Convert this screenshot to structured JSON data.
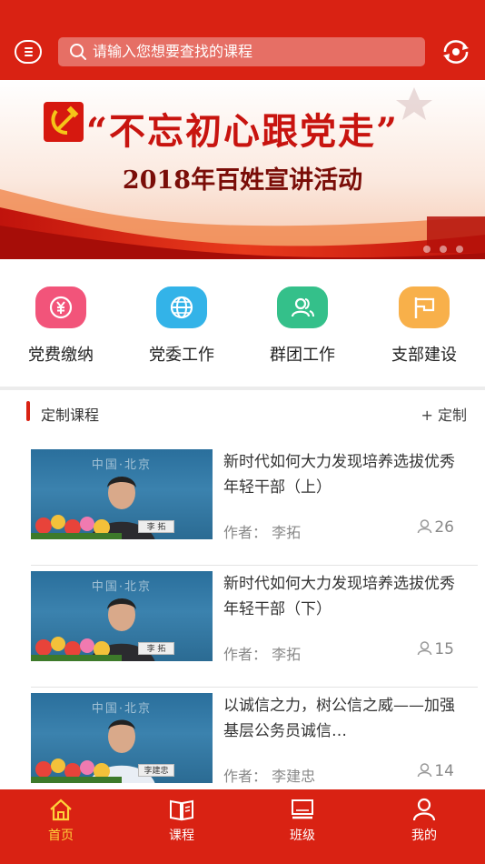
{
  "header": {
    "search_placeholder": "请输入您想要查找的课程",
    "icons": {
      "menu": "menu-icon",
      "search": "search-icon",
      "refresh": "refresh-icon"
    },
    "brand_color": "#d92213"
  },
  "banner": {
    "title": "“不忘初心跟党走”",
    "subtitle": "2018年百姓宣讲活动"
  },
  "quick_menu": [
    {
      "label": "党费缴纳",
      "icon": "yuan-exchange-icon",
      "color": "#f2547a"
    },
    {
      "label": "党委工作",
      "icon": "globe-icon",
      "color": "#33b3e8"
    },
    {
      "label": "群团工作",
      "icon": "group-icon",
      "color": "#34c08a"
    },
    {
      "label": "支部建设",
      "icon": "flag-icon",
      "color": "#f8b04a"
    }
  ],
  "section": {
    "title": "定制课程",
    "action": "+ 定制"
  },
  "courses": [
    {
      "title": "新时代如何大力发现培养选拔优秀年轻干部（上）",
      "author": "作者：  李拓",
      "count": "26",
      "thumb_city": "中国·北京",
      "thumb_name": "李 拓"
    },
    {
      "title": "新时代如何大力发现培养选拔优秀年轻干部（下）",
      "author": "作者：  李拓",
      "count": "15",
      "thumb_city": "中国·北京",
      "thumb_name": "李 拓"
    },
    {
      "title": "以诚信之力，树公信之威——加强基层公务员诚信…",
      "author": "作者：  李建忠",
      "count": "14",
      "thumb_city": "中国·北京",
      "thumb_name": "李建忠"
    }
  ],
  "tabbar": [
    {
      "label": "首页",
      "icon": "home-icon",
      "active": true
    },
    {
      "label": "课程",
      "icon": "book-icon",
      "active": false
    },
    {
      "label": "班级",
      "icon": "monitor-icon",
      "active": false
    },
    {
      "label": "我的",
      "icon": "user-icon",
      "active": false
    }
  ],
  "colors": {
    "active_tab": "#ffd23a",
    "banner_red": "#c8140f"
  }
}
